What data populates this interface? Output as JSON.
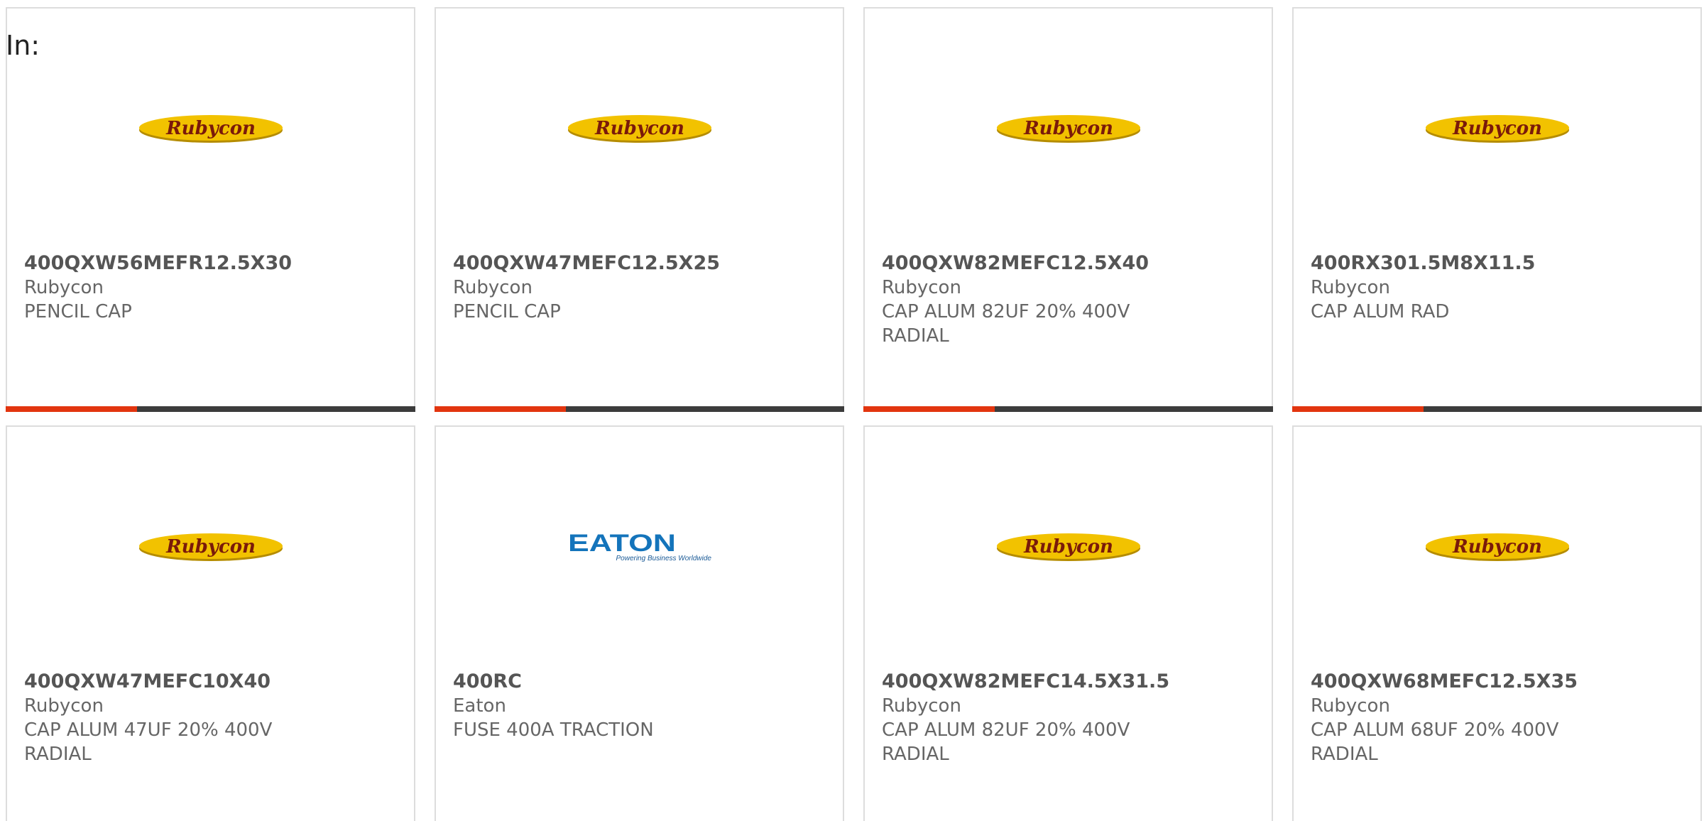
{
  "filter_label": "In:",
  "colors": {
    "accent_red": "#e2350f",
    "bar_dark": "#3c3c3c",
    "rubycon_yellow": "#f2c200",
    "rubycon_text": "#7a1a0a",
    "eaton_blue": "#1474bb"
  },
  "products": [
    {
      "part_number": "400QXW56MEFR12.5X30",
      "manufacturer": "Rubycon",
      "description": "PENCIL CAP",
      "logo": "rubycon-logo",
      "logo_text": "Rubycon",
      "progress": 0.32
    },
    {
      "part_number": "400QXW47MEFC12.5X25",
      "manufacturer": "Rubycon",
      "description": "PENCIL CAP",
      "logo": "rubycon-logo",
      "logo_text": "Rubycon",
      "progress": 0.32
    },
    {
      "part_number": "400QXW82MEFC12.5X40",
      "manufacturer": "Rubycon",
      "description": "CAP ALUM 82UF 20% 400V RADIAL",
      "logo": "rubycon-logo",
      "logo_text": "Rubycon",
      "progress": 0.32
    },
    {
      "part_number": "400RX301.5M8X11.5",
      "manufacturer": "Rubycon",
      "description": "CAP ALUM RAD",
      "logo": "rubycon-logo",
      "logo_text": "Rubycon",
      "progress": 0.32
    },
    {
      "part_number": "400QXW47MEFC10X40",
      "manufacturer": "Rubycon",
      "description": "CAP ALUM 47UF 20% 400V RADIAL",
      "logo": "rubycon-logo",
      "logo_text": "Rubycon"
    },
    {
      "part_number": "400RC",
      "manufacturer": "Eaton",
      "description": "FUSE 400A TRACTION",
      "logo": "eaton-logo",
      "logo_text": "EATON",
      "logo_tagline": "Powering Business Worldwide"
    },
    {
      "part_number": "400QXW82MEFC14.5X31.5",
      "manufacturer": "Rubycon",
      "description": "CAP ALUM 82UF 20% 400V RADIAL",
      "logo": "rubycon-logo",
      "logo_text": "Rubycon"
    },
    {
      "part_number": "400QXW68MEFC12.5X35",
      "manufacturer": "Rubycon",
      "description": "CAP ALUM 68UF 20% 400V RADIAL",
      "logo": "rubycon-logo",
      "logo_text": "Rubycon"
    }
  ]
}
